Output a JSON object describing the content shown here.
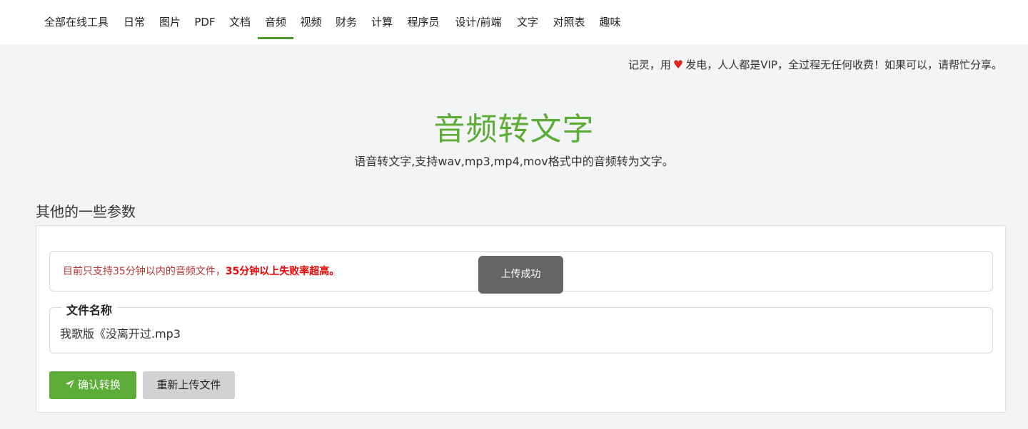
{
  "nav": {
    "items": [
      {
        "label": "全部在线工具"
      },
      {
        "label": "日常"
      },
      {
        "label": "图片"
      },
      {
        "label": "PDF"
      },
      {
        "label": "文档"
      },
      {
        "label": "音频",
        "active": true
      },
      {
        "label": "视频"
      },
      {
        "label": "财务"
      },
      {
        "label": "计算"
      },
      {
        "label": "程序员"
      },
      {
        "label": "设计/前端"
      },
      {
        "label": "文字"
      },
      {
        "label": "对照表"
      },
      {
        "label": "趣味"
      }
    ]
  },
  "notice": {
    "prefix": "记灵，用",
    "heart": "heart-icon",
    "suffix": "发电，人人都是VIP，全过程无任何收费！如果可以，请帮忙分享。"
  },
  "page": {
    "title": "音频转文字",
    "subtitle": "语音转文字,支持wav,mp3,mp4,mov格式中的音频转为文字。"
  },
  "params": {
    "section_title": "其他的一些参数",
    "warning_normal": "目前只支持35分钟以内的音频文件，",
    "warning_bold": "35分钟以上失败率超高。",
    "file_legend": "文件名称",
    "file_name": "我歌版《没离开过.mp3",
    "confirm_label": "确认转换",
    "reupload_label": "重新上传文件"
  },
  "toast": {
    "text": "上传成功"
  },
  "colors": {
    "accent": "#5cad38",
    "warning_text": "#b33333",
    "warning_bold": "#ee0000",
    "toast_bg": "#505050"
  }
}
